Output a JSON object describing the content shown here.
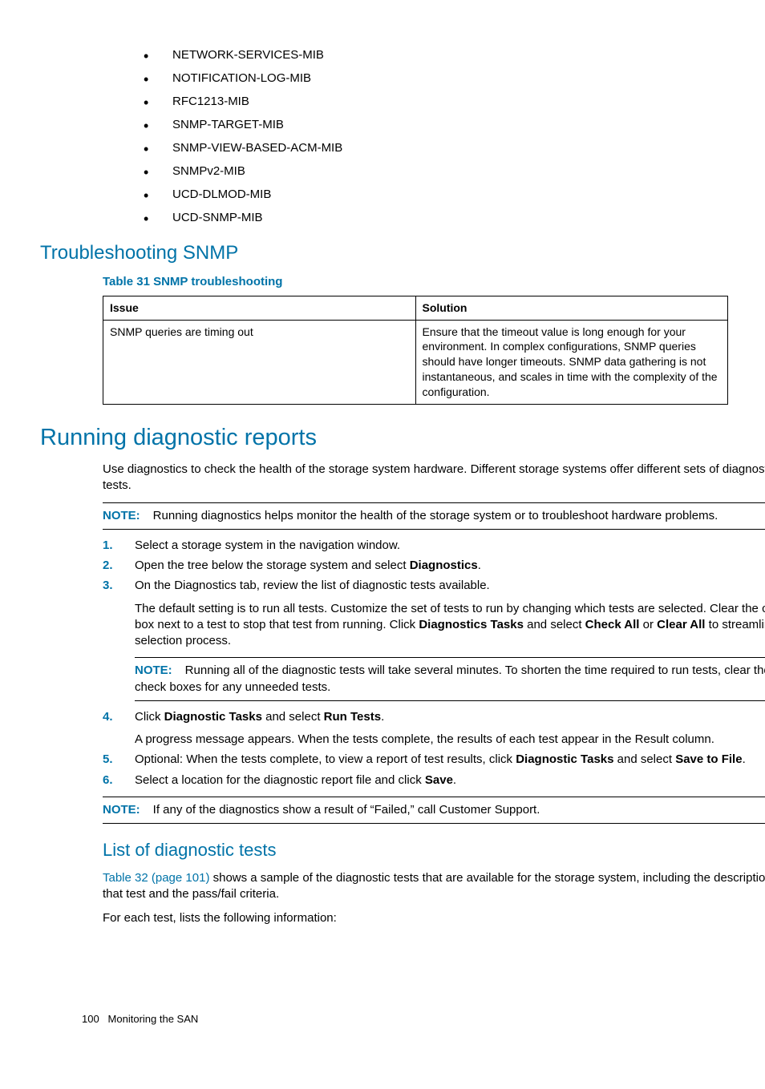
{
  "mibs": [
    "NETWORK-SERVICES-MIB",
    "NOTIFICATION-LOG-MIB",
    "RFC1213-MIB",
    "SNMP-TARGET-MIB",
    "SNMP-VIEW-BASED-ACM-MIB",
    "SNMPv2-MIB",
    "UCD-DLMOD-MIB",
    "UCD-SNMP-MIB"
  ],
  "troubleshoot_heading": "Troubleshooting SNMP",
  "table31": {
    "caption": "Table 31 SNMP troubleshooting",
    "col1": "Issue",
    "col2": "Solution",
    "row1c1": "SNMP queries are timing out",
    "row1c2": "Ensure that the timeout value is long enough for your environment. In complex configurations, SNMP queries should have longer timeouts. SNMP data gathering is not instantaneous, and scales in time with the complexity of the configuration."
  },
  "diag": {
    "heading": "Running diagnostic reports",
    "intro": "Use diagnostics to check the health of the storage system hardware. Different storage systems offer different sets of diagnostic tests.",
    "note_label": "NOTE:",
    "note1": "Running diagnostics helps monitor the health of the storage system or to troubleshoot hardware problems.",
    "step1": "Select a storage system in the navigation window.",
    "step2a": "Open the tree below the storage system and select ",
    "step2b": "Diagnostics",
    "step2c": ".",
    "step3a": "On the Diagnostics tab, review the list of diagnostic tests available.",
    "step3p1a": "The default setting is to run all tests. Customize the set of tests to run by changing which tests are selected. Clear the check box next to a test to stop that test from running. Click ",
    "step3p1b": "Diagnostics Tasks",
    "step3p1c": " and select ",
    "step3p1d": "Check All",
    "step3p1e": " or ",
    "step3p1f": "Clear All",
    "step3p1g": " to streamline the selection process.",
    "step3note": "Running all of the diagnostic tests will take several minutes. To shorten the time required to run tests, clear the check boxes for any unneeded tests.",
    "step4a": "Click ",
    "step4b": "Diagnostic Tasks",
    "step4c": " and select ",
    "step4d": "Run Tests",
    "step4e": ".",
    "step4p": "A progress message appears. When the tests complete, the results of each test appear in the Result column.",
    "step5a": "Optional: When the tests complete, to view a report of test results, click ",
    "step5b": "Diagnostic Tasks",
    "step5c": " and select ",
    "step5d": "Save to File",
    "step5e": ".",
    "step6a": "Select a location for the diagnostic report file and click ",
    "step6b": "Save",
    "step6c": ".",
    "note2": "If any of the diagnostics show a result of “Failed,” call Customer Support.",
    "list_heading": "List of diagnostic tests",
    "list_linktext": "Table 32 (page 101)",
    "list_p1b": " shows a sample of the diagnostic tests that are available for the storage system, including the description of that test and the pass/fail criteria.",
    "list_p2": "For each test, lists the following information:"
  },
  "footer_page": "100",
  "footer_text": "Monitoring the SAN"
}
